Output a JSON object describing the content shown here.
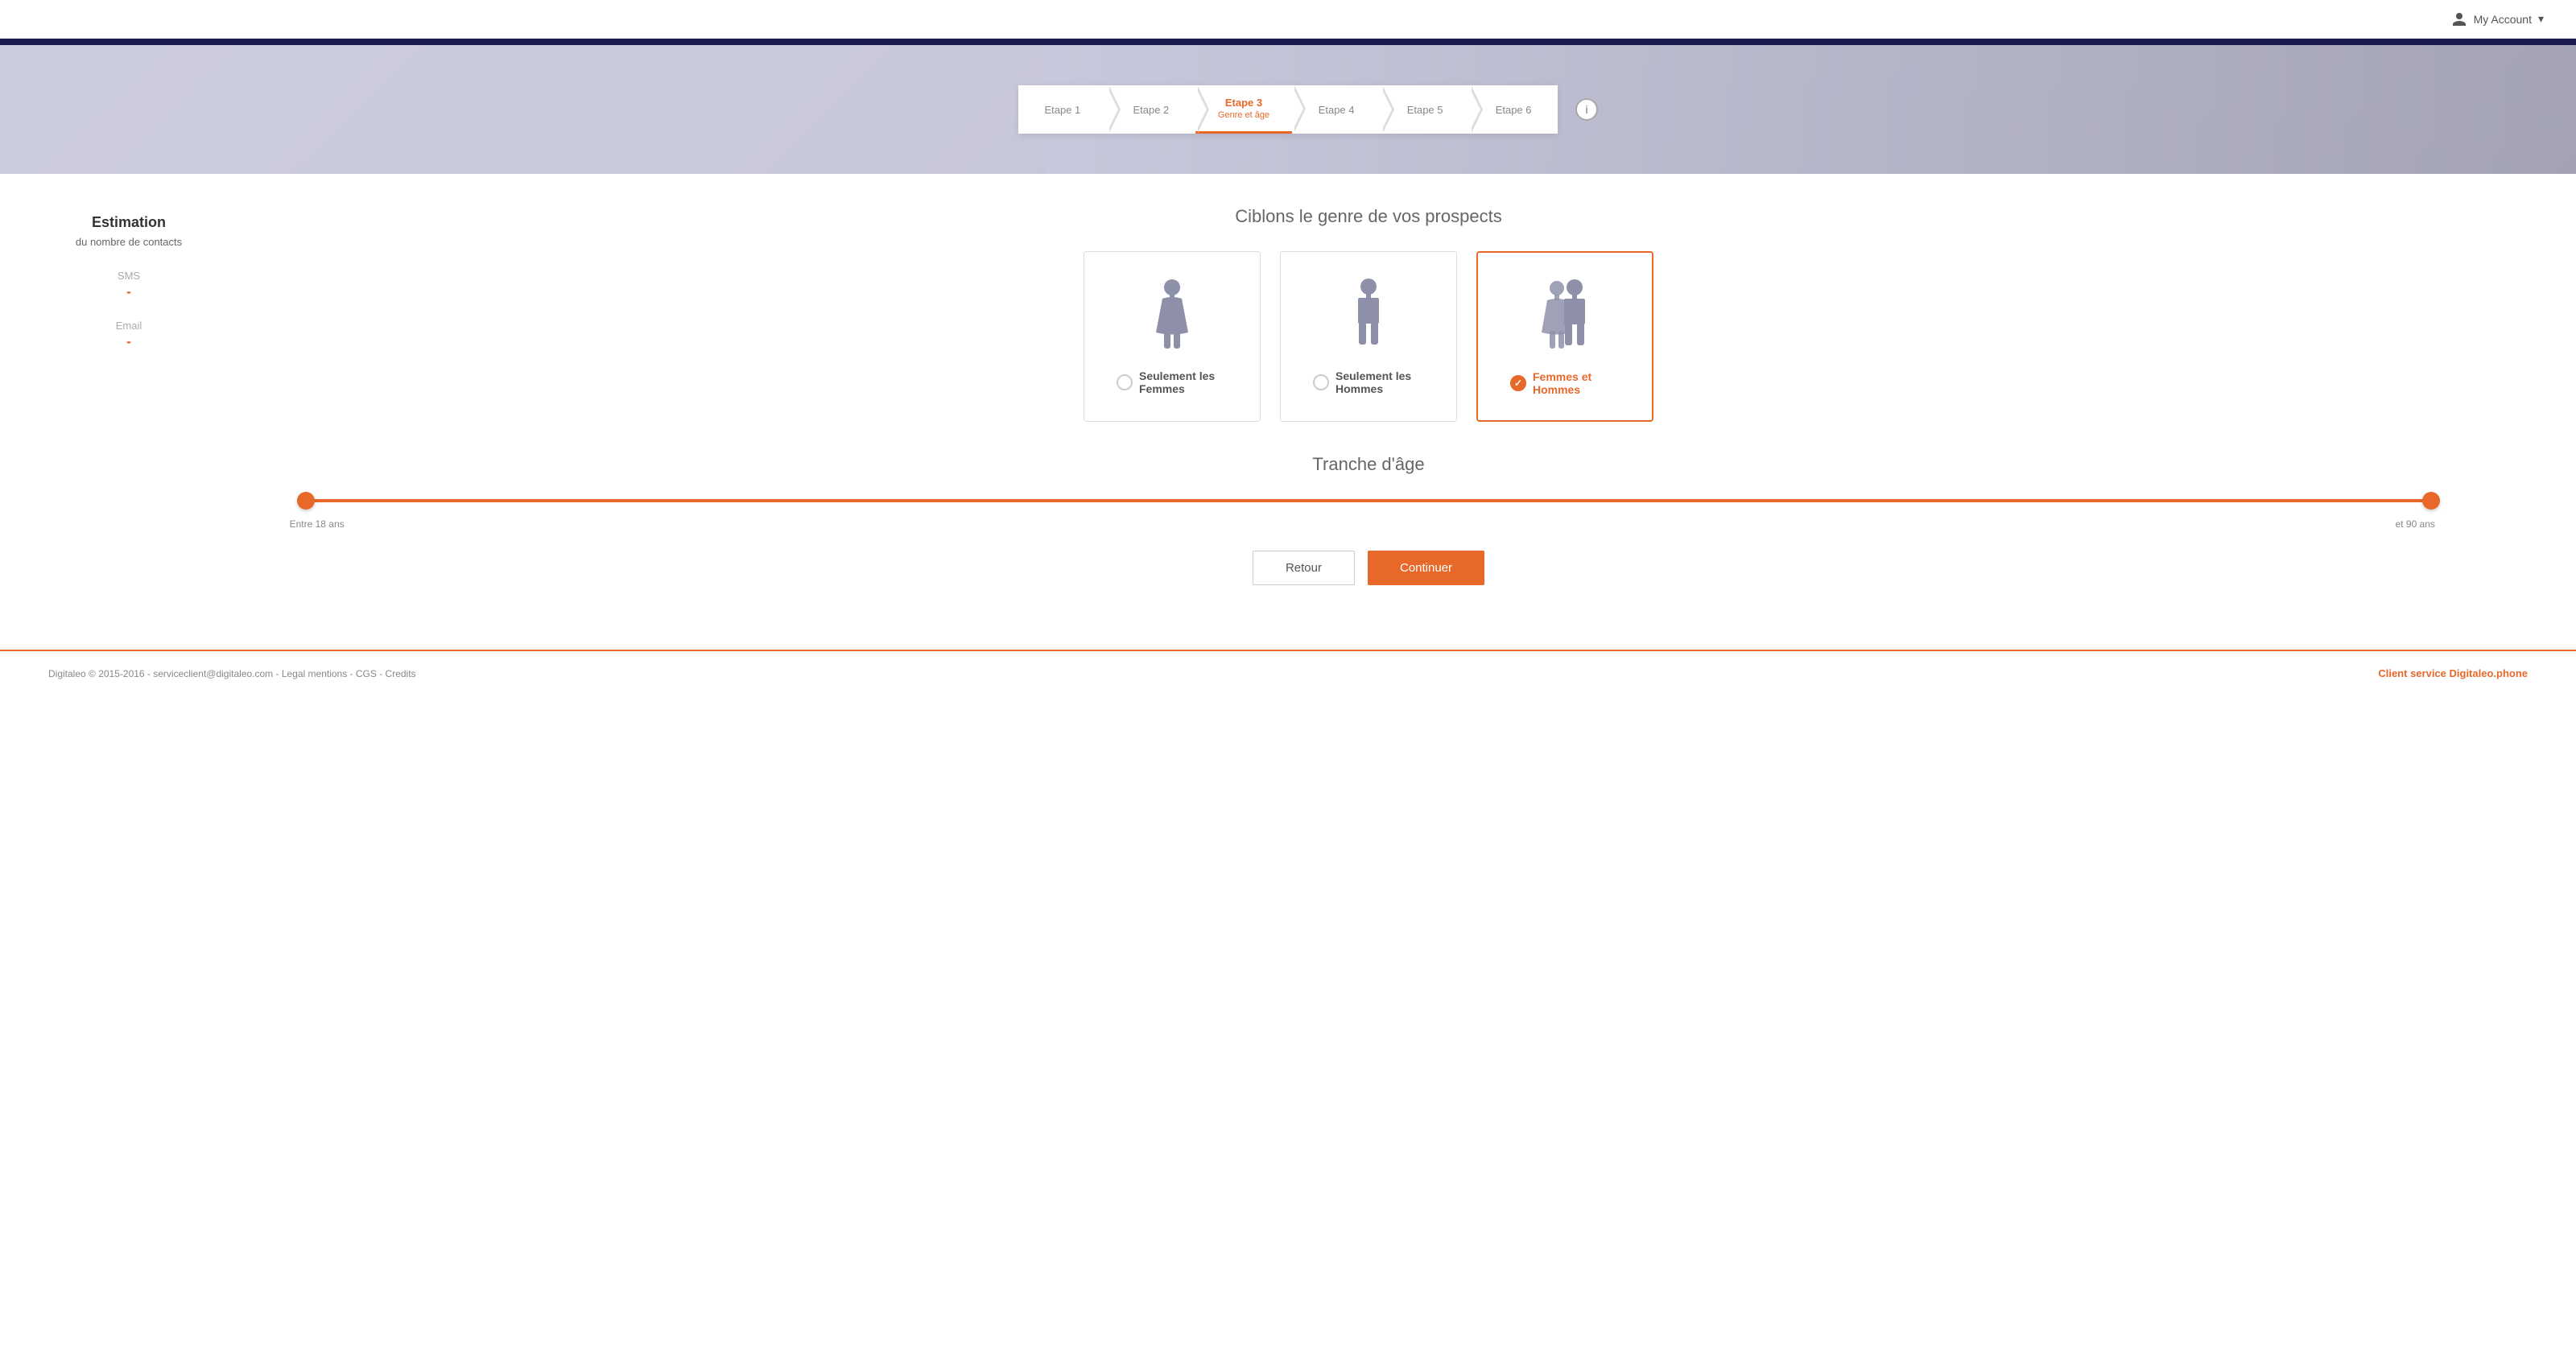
{
  "header": {
    "account_label": "My Account",
    "caret": "▾"
  },
  "steps": [
    {
      "id": "etape1",
      "label": "Etape 1",
      "sub": "",
      "active": false
    },
    {
      "id": "etape2",
      "label": "Etape 2",
      "sub": "",
      "active": false
    },
    {
      "id": "etape3",
      "label": "Etape 3",
      "sub": "Genre et âge",
      "active": true
    },
    {
      "id": "etape4",
      "label": "Etape 4",
      "sub": "",
      "active": false
    },
    {
      "id": "etape5",
      "label": "Etape 5",
      "sub": "",
      "active": false
    },
    {
      "id": "etape6",
      "label": "Etape 6",
      "sub": "",
      "active": false
    }
  ],
  "estimation": {
    "title": "Estimation",
    "subtitle": "du nombre de contacts",
    "sms_label": "SMS",
    "sms_value": "-",
    "email_label": "Email",
    "email_value": "-"
  },
  "gender_section": {
    "title": "Ciblons le genre de vos prospects",
    "options": [
      {
        "id": "femmes",
        "label": "Seulement les Femmes",
        "selected": false,
        "gender": "female"
      },
      {
        "id": "hommes",
        "label": "Seulement les Hommes",
        "selected": false,
        "gender": "male"
      },
      {
        "id": "both",
        "label": "Femmes et Hommes",
        "selected": true,
        "gender": "both"
      }
    ]
  },
  "age_section": {
    "title": "Tranche d'âge",
    "min_age": 18,
    "max_age": 90,
    "label_left": "Entre 18 ans",
    "label_right": "et 90 ans"
  },
  "buttons": {
    "retour": "Retour",
    "continuer": "Continuer"
  },
  "footer": {
    "left": "Digitaleo © 2015-2016 - serviceclient@digitaleo.com - Legal mentions - CGS - Credits",
    "right_prefix": "Client service ",
    "right_link": "Digitaleo.phone"
  }
}
